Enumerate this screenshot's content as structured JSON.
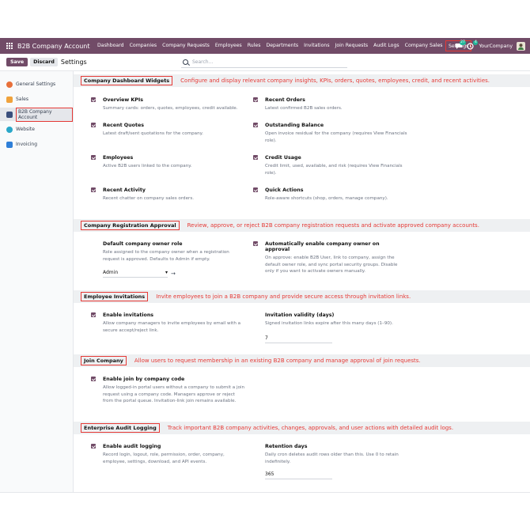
{
  "topbar": {
    "brand": "B2B Company Account",
    "nav": [
      "Dashboard",
      "Companies",
      "Company Requests",
      "Employees",
      "Rules",
      "Departments",
      "Invitations",
      "Join Requests",
      "Audit Logs",
      "Company Sales",
      "Settings"
    ],
    "active_nav": "Settings",
    "chat_count": "27",
    "activity_count": "4",
    "company": "YourCompany"
  },
  "controlbar": {
    "save": "Save",
    "discard": "Discard",
    "title": "Settings",
    "search_placeholder": "Search..."
  },
  "sidebar": {
    "items": [
      {
        "label": "General Settings",
        "color": "#e8703a"
      },
      {
        "label": "Sales",
        "color": "#f0a23c"
      },
      {
        "label": "B2B Company Account",
        "color": "#3b4f7c"
      },
      {
        "label": "Website",
        "color": "#2aa7c9"
      },
      {
        "label": "Invoicing",
        "color": "#2f7fd8"
      }
    ]
  },
  "sections": {
    "dashboard": {
      "title": "Company Dashboard Widgets",
      "note": "Configure and display relevant company insights, KPIs, orders, quotes, employees, credit, and recent activities.",
      "items": [
        {
          "title": "Overview KPIs",
          "desc": "Summary cards: orders, quotes, employees, credit available."
        },
        {
          "title": "Recent Orders",
          "desc": "Latest confirmed B2B sales orders."
        },
        {
          "title": "Recent Quotes",
          "desc": "Latest draft/sent quotations for the company."
        },
        {
          "title": "Outstanding Balance",
          "desc": "Open invoice residual for the company (requires View Financials role)."
        },
        {
          "title": "Employees",
          "desc": "Active B2B users linked to the company."
        },
        {
          "title": "Credit Usage",
          "desc": "Credit limit, used, available, and risk (requires View Financials role)."
        },
        {
          "title": "Recent Activity",
          "desc": "Recent chatter on company sales orders."
        },
        {
          "title": "Quick Actions",
          "desc": "Role-aware shortcuts (shop, orders, manage company)."
        }
      ]
    },
    "registration": {
      "title": "Company Registration Approval",
      "note": "Review, approve, or reject B2B company registration requests and activate approved company accounts.",
      "owner_role_title": "Default company owner role",
      "owner_role_desc": "Role assigned to the company owner when a registration request is approved. Defaults to Admin if empty.",
      "owner_role_value": "Admin",
      "auto_title": "Automatically enable company owner on approval",
      "auto_desc": "On approve: enable B2B User, link to company, assign the default owner role, and sync portal security groups. Disable only if you want to activate owners manually."
    },
    "invitations": {
      "title": "Employee Invitations",
      "note": "Invite employees to join a B2B company and provide secure access through invitation links.",
      "enable_title": "Enable invitations",
      "enable_desc": "Allow company managers to invite employees by email with a secure accept/reject link.",
      "validity_title": "Invitation validity (days)",
      "validity_desc": "Signed invitation links expire after this many days (1–90).",
      "validity_value": "7"
    },
    "join": {
      "title": "Join Company",
      "note": "Allow users to request membership in an existing B2B company and manage approval of join requests.",
      "enable_title": "Enable join by company code",
      "enable_desc": "Allow logged-in portal users without a company to submit a join request using a company code. Managers approve or reject from the portal queue. Invitation-link join remains available."
    },
    "audit": {
      "title": "Enterprise Audit Logging",
      "note": "Track important B2B company activities, changes, approvals, and user actions with detailed audit logs.",
      "enable_title": "Enable audit logging",
      "enable_desc": "Record login, logout, role, permission, order, company, employee, settings, download, and API events.",
      "retention_title": "Retention days",
      "retention_desc": "Daily cron deletes audit rows older than this. Use 0 to retain indefinitely.",
      "retention_value": "365"
    }
  }
}
